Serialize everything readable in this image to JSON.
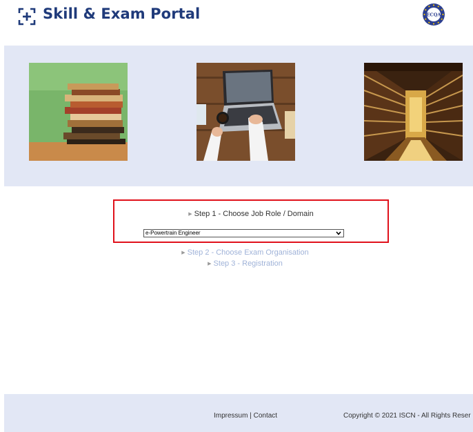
{
  "header": {
    "title": "Skill & Exam Portal",
    "badge_text": "ECQA"
  },
  "banner": {
    "images": [
      {
        "icon": "stacked-books-image"
      },
      {
        "icon": "laptop-typing-image"
      },
      {
        "icon": "library-hall-image"
      }
    ]
  },
  "steps": {
    "step1_label": "Step 1 - Choose Job Role / Domain",
    "role_select_value": "e-Powertrain Engineer",
    "step2_label": "Step 2 - Choose Exam Organisation",
    "step3_label": "Step 3 - Registration",
    "bullet": "▶"
  },
  "footer": {
    "impressum": "Impressum",
    "separator": "|",
    "contact": "Contact",
    "copyright": "Copyright © 2021 ISCN - All Rights Reser"
  },
  "colors": {
    "brand": "#1f3a7a",
    "highlight_border": "#e0101a",
    "banner_bg": "#e2e7f5",
    "inactive_step": "#9fb2d8"
  }
}
